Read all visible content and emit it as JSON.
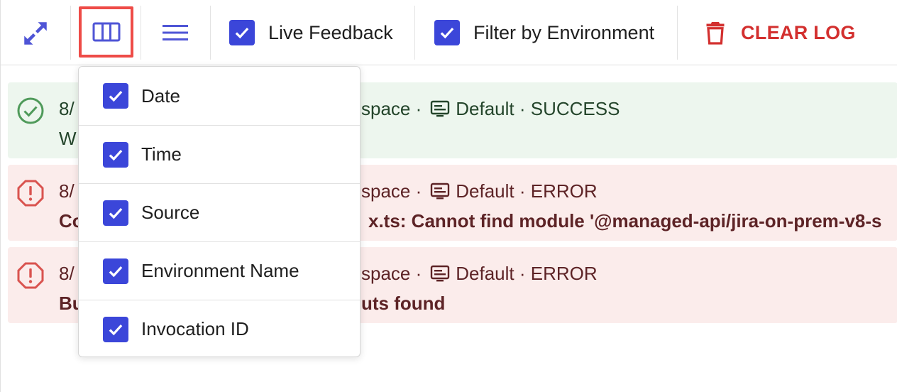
{
  "toolbar": {
    "live_feedback": {
      "label": "Live Feedback",
      "checked": true
    },
    "filter_env": {
      "label": "Filter by Environment",
      "checked": true
    },
    "clear_log": {
      "label": "CLEAR LOG"
    }
  },
  "colors": {
    "accent": "#3b46d9",
    "danger": "#d3302f",
    "highlight": "#ee4b47",
    "success_bg": "#edf6ee",
    "error_bg": "#fbeceb"
  },
  "logs": [
    {
      "status": "success",
      "date_visible": "8/",
      "meta_visible": "space ·",
      "environment": "Default",
      "status_label": "SUCCESS",
      "message_visible": "W"
    },
    {
      "status": "error",
      "date_visible": "8/",
      "meta_visible": "space ·",
      "environment": "Default",
      "status_label": "ERROR",
      "message_start": "Co",
      "message_visible": "x.ts: Cannot find module '@managed-api/jira-on-prem-v8-s"
    },
    {
      "status": "error",
      "date_visible": "8/",
      "meta_visible": "space ·",
      "environment": "Default",
      "status_label": "ERROR",
      "message_start": "Bu",
      "message_visible": "uts found"
    }
  ],
  "column_menu": {
    "items": [
      {
        "label": "Date",
        "checked": true
      },
      {
        "label": "Time",
        "checked": true
      },
      {
        "label": "Source",
        "checked": true
      },
      {
        "label": "Environment Name",
        "checked": true
      },
      {
        "label": "Invocation ID",
        "checked": true
      }
    ]
  },
  "icons": {
    "expand": "expand-diagonal-icon",
    "columns": "view-columns-icon",
    "rows": "view-rows-icon",
    "trash": "trash-icon",
    "success": "check-circle-icon",
    "error": "error-octagon-icon",
    "environment": "environment-monitor-icon"
  }
}
